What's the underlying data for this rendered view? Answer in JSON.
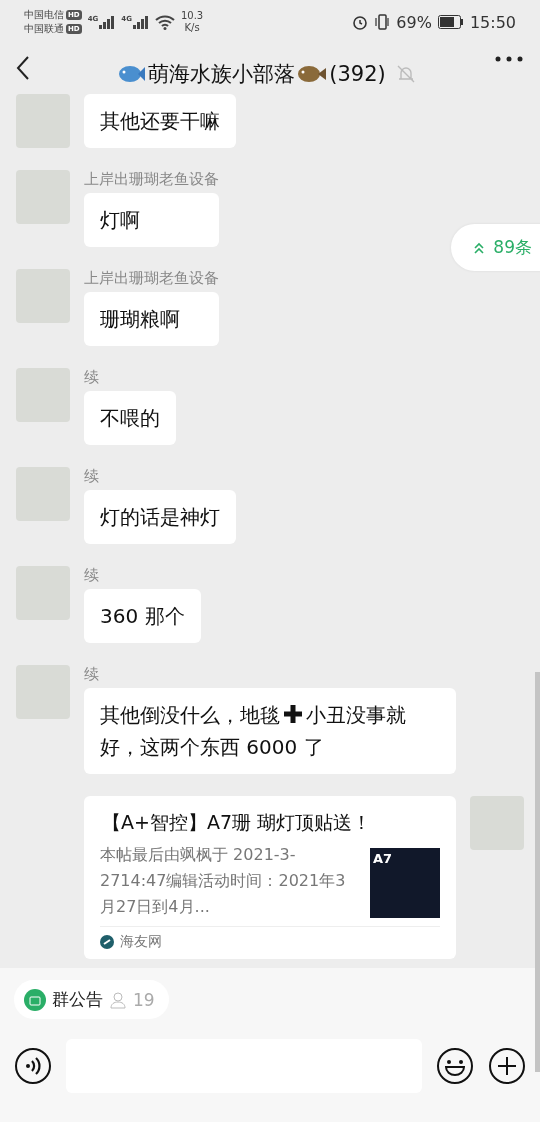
{
  "status_bar": {
    "carriers": [
      {
        "name": "中国电信",
        "badge": "HD"
      },
      {
        "name": "中国联通",
        "badge": "HD"
      }
    ],
    "signals": [
      "4G",
      "4G"
    ],
    "speed": "10.3",
    "speed_unit": "K/s",
    "battery": "69%",
    "time": "15:50"
  },
  "header": {
    "title": "萌海水族小部落",
    "count": "(392)",
    "muted": true
  },
  "new_messages": {
    "label": "89条"
  },
  "messages": [
    {
      "kind": "text",
      "segments": [
        "其他还要干嘛"
      ]
    },
    {
      "kind": "text",
      "sender": "上岸出珊瑚老鱼设备",
      "segments": [
        "灯啊"
      ]
    },
    {
      "kind": "text",
      "sender": "上岸出珊瑚老鱼设备",
      "segments": [
        "珊瑚粮啊"
      ]
    },
    {
      "kind": "text",
      "sender": "续",
      "segments": [
        "不喂的"
      ]
    },
    {
      "kind": "text",
      "sender": "续",
      "segments": [
        "灯的话是神灯"
      ]
    },
    {
      "kind": "text",
      "sender": "续",
      "segments": [
        "360 那个"
      ]
    },
    {
      "kind": "text",
      "sender": "续",
      "segments": [
        "其他倒没什么，地毯",
        "小丑没事就好，这两个东西 6000 了"
      ]
    },
    {
      "kind": "link",
      "title": "【A+智控】A7珊 瑚灯顶贴送！",
      "description": "本帖最后由飒枫于 2021-3-2714:47编辑活动时间：2021年3月27日到4月...",
      "thumb_label": "A7",
      "source": "海友网"
    }
  ],
  "notice": {
    "label": "群公告",
    "count": "19"
  }
}
